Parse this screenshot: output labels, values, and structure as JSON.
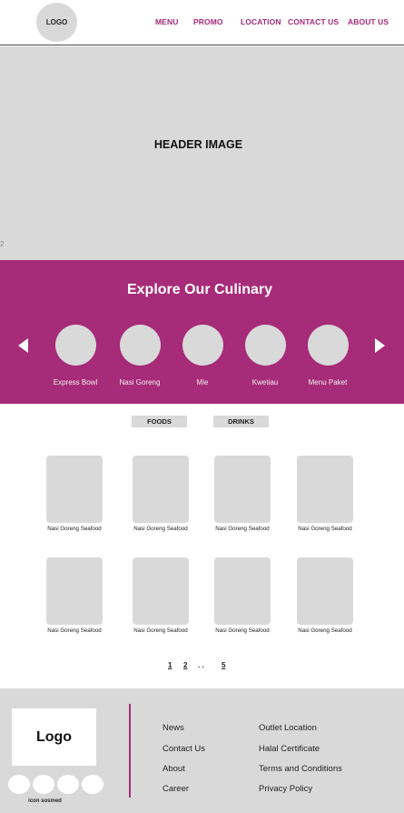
{
  "nav": {
    "logo": "LOGO",
    "links": [
      "MENU",
      "PROMO",
      "LOCATION",
      "CONTACT US",
      "ABOUT US"
    ]
  },
  "hero": {
    "title": "HEADER IMAGE",
    "marker": "2"
  },
  "culinary": {
    "title": "Explore Our Culinary",
    "categories": [
      "Express Bowl",
      "Nasi Goreng",
      "Mie",
      "Kwetiau",
      "Menu Paket"
    ]
  },
  "menu": {
    "tabs": [
      "FOODS",
      "DRINKS"
    ],
    "items": [
      "Nasi Goreng Seafood",
      "Nasi Goreng Seafood",
      "Nasi Goreng Seafood",
      "Nasi Goreng Seafood",
      "Nasi Goreng Seafood",
      "Nasi Goreng Seafood",
      "Nasi Goreng Seafood",
      "Nasi Goreng Seafood"
    ]
  },
  "pagination": {
    "pages": [
      "1",
      "2",
      ". .",
      "5"
    ]
  },
  "footer": {
    "logo": "Logo",
    "social_label": "icon sosmed",
    "col1": [
      "News",
      "Contact Us",
      "About",
      "Career"
    ],
    "col2": [
      "Outlet Location",
      "Halal Certificate",
      "Terms and Conditions",
      "Privacy Policy"
    ]
  },
  "colors": {
    "accent": "#a62b78",
    "placeholder": "#d9d9d9"
  }
}
